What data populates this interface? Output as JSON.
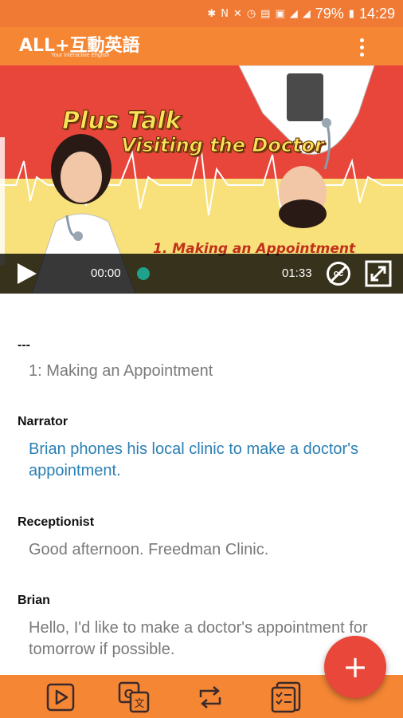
{
  "status_bar": {
    "battery": "79%",
    "time": "14:29",
    "icons": [
      "bluetooth-icon",
      "nfc-icon",
      "mute-icon",
      "alarm-icon",
      "volte-icon",
      "sim-icon",
      "4g-signal-icon",
      "3g-signal-icon",
      "battery-icon"
    ]
  },
  "app_bar": {
    "logo_text": "ALL+互動英語",
    "logo_tagline": "Your Interactive English",
    "menu_icon": "more-vert-icon"
  },
  "video": {
    "title_line1": "Plus Talk",
    "title_line2": "Visiting the Doctor",
    "subtitle": "1. Making an Appointment",
    "current_time": "00:00",
    "duration": "01:33",
    "progress": 0.0
  },
  "transcript": {
    "section_marker": "---",
    "section_title": "1: Making an Appointment",
    "entries": [
      {
        "speaker": "Narrator",
        "text": "Brian phones his local clinic to make a doctor's appointment."
      },
      {
        "speaker": "Receptionist",
        "text": "Good afternoon. Freedman Clinic."
      },
      {
        "speaker": "Brian",
        "text": "Hello, I'd like to make a doctor's appointment for tomorrow if possible."
      }
    ]
  },
  "fab": {
    "label": "+"
  },
  "bottom_nav": {
    "items": [
      "video-play-icon",
      "translate-icon",
      "repeat-icon",
      "quiz-checklist-icon"
    ]
  },
  "colors": {
    "accent": "#f58634",
    "fab": "#e8473a",
    "highlight_text": "#2a7fb4",
    "scrubber": "#1fa28b"
  }
}
